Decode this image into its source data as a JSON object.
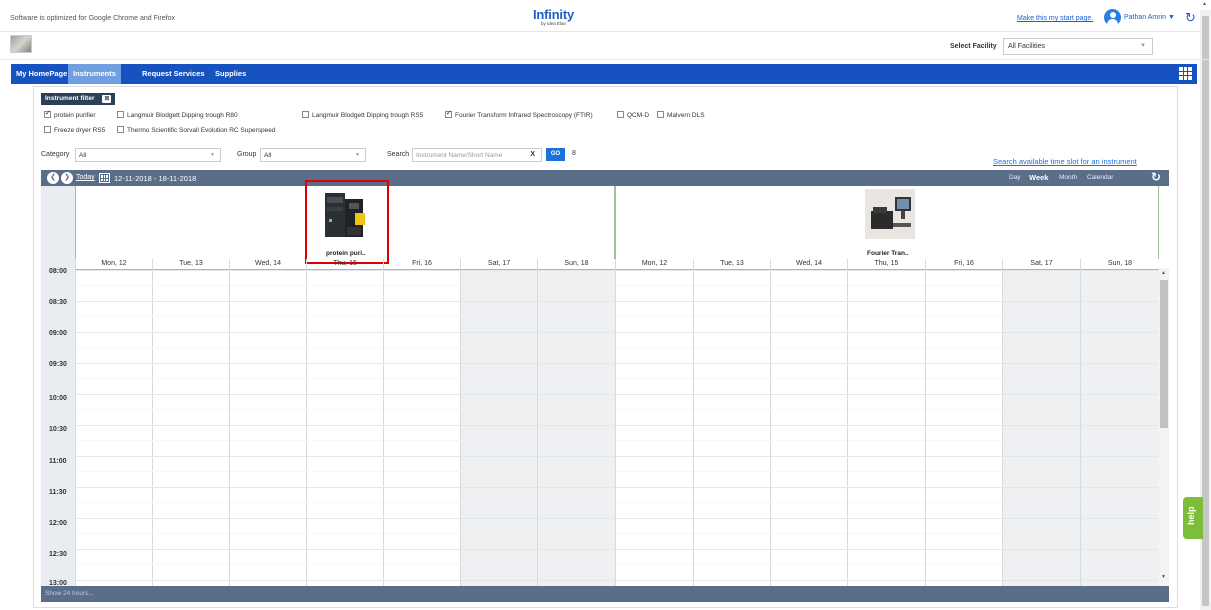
{
  "top": {
    "notice": "Software is optimized for Google Chrome and Firefox",
    "logo_main": "Infinity",
    "logo_sub": "by Idea Elan",
    "start_page_link": "Make this my start page.",
    "user_name": "Pathan Amrin ▼"
  },
  "facility": {
    "label": "Select Facility",
    "value": "All Facilities"
  },
  "nav": {
    "items": [
      "My HomePage",
      "Instruments",
      "Request Services",
      "Supplies"
    ],
    "active": "Instruments"
  },
  "filter": {
    "badge": "Instrument filter",
    "instruments": [
      {
        "label": "protein purifier",
        "checked": true
      },
      {
        "label": "Langmuir Blodgett Dipping trough R80",
        "checked": false
      },
      {
        "label": "Langmuir Blodgett Dipping trough RS5",
        "checked": false
      },
      {
        "label": "Fourier Transform Infrared Spectroscopy (FTIR)",
        "checked": true
      },
      {
        "label": "QCM-D",
        "checked": false
      },
      {
        "label": "Malvern DLS",
        "checked": false
      },
      {
        "label": "Freeze dryer RS5",
        "checked": false
      },
      {
        "label": "Thermo Scientific Sorvall Evolution RC Superspeed",
        "checked": false
      }
    ],
    "category_label": "Category",
    "category_value": "All",
    "group_label": "Group",
    "group_value": "All",
    "search_label": "Search",
    "search_placeholder": "Instrument Name/Short Name",
    "go_label": "GO",
    "count": "8",
    "slot_link": "Search available time slot for an instrument"
  },
  "calendar": {
    "today": "Today",
    "date_range": "12-11-2018 - 18-11-2018",
    "views": [
      "Day",
      "Week",
      "Month",
      "Calendar"
    ],
    "active_view": "Week",
    "instruments": [
      {
        "short_name": "protein puri.."
      },
      {
        "short_name": "Fourier Tran.."
      }
    ],
    "days": [
      "Mon, 12",
      "Tue, 13",
      "Wed, 14",
      "Thu, 15",
      "Fri, 16",
      "Sat, 17",
      "Sun, 18",
      "Mon, 12",
      "Tue, 13",
      "Wed, 14",
      "Thu, 15",
      "Fri, 16",
      "Sat, 17",
      "Sun, 18"
    ],
    "times": [
      "08:00",
      "08:30",
      "09:00",
      "09:30",
      "10:00",
      "10:30",
      "11:00",
      "11:30",
      "12:00",
      "12:30",
      "13:00"
    ],
    "footer": "Show 24 hours..."
  },
  "help": {
    "label": "help"
  },
  "colors": {
    "nav": "#1753c0",
    "calendar_bar": "#5a6e8a",
    "highlight": "#e00000",
    "help": "#7cbd3a"
  }
}
